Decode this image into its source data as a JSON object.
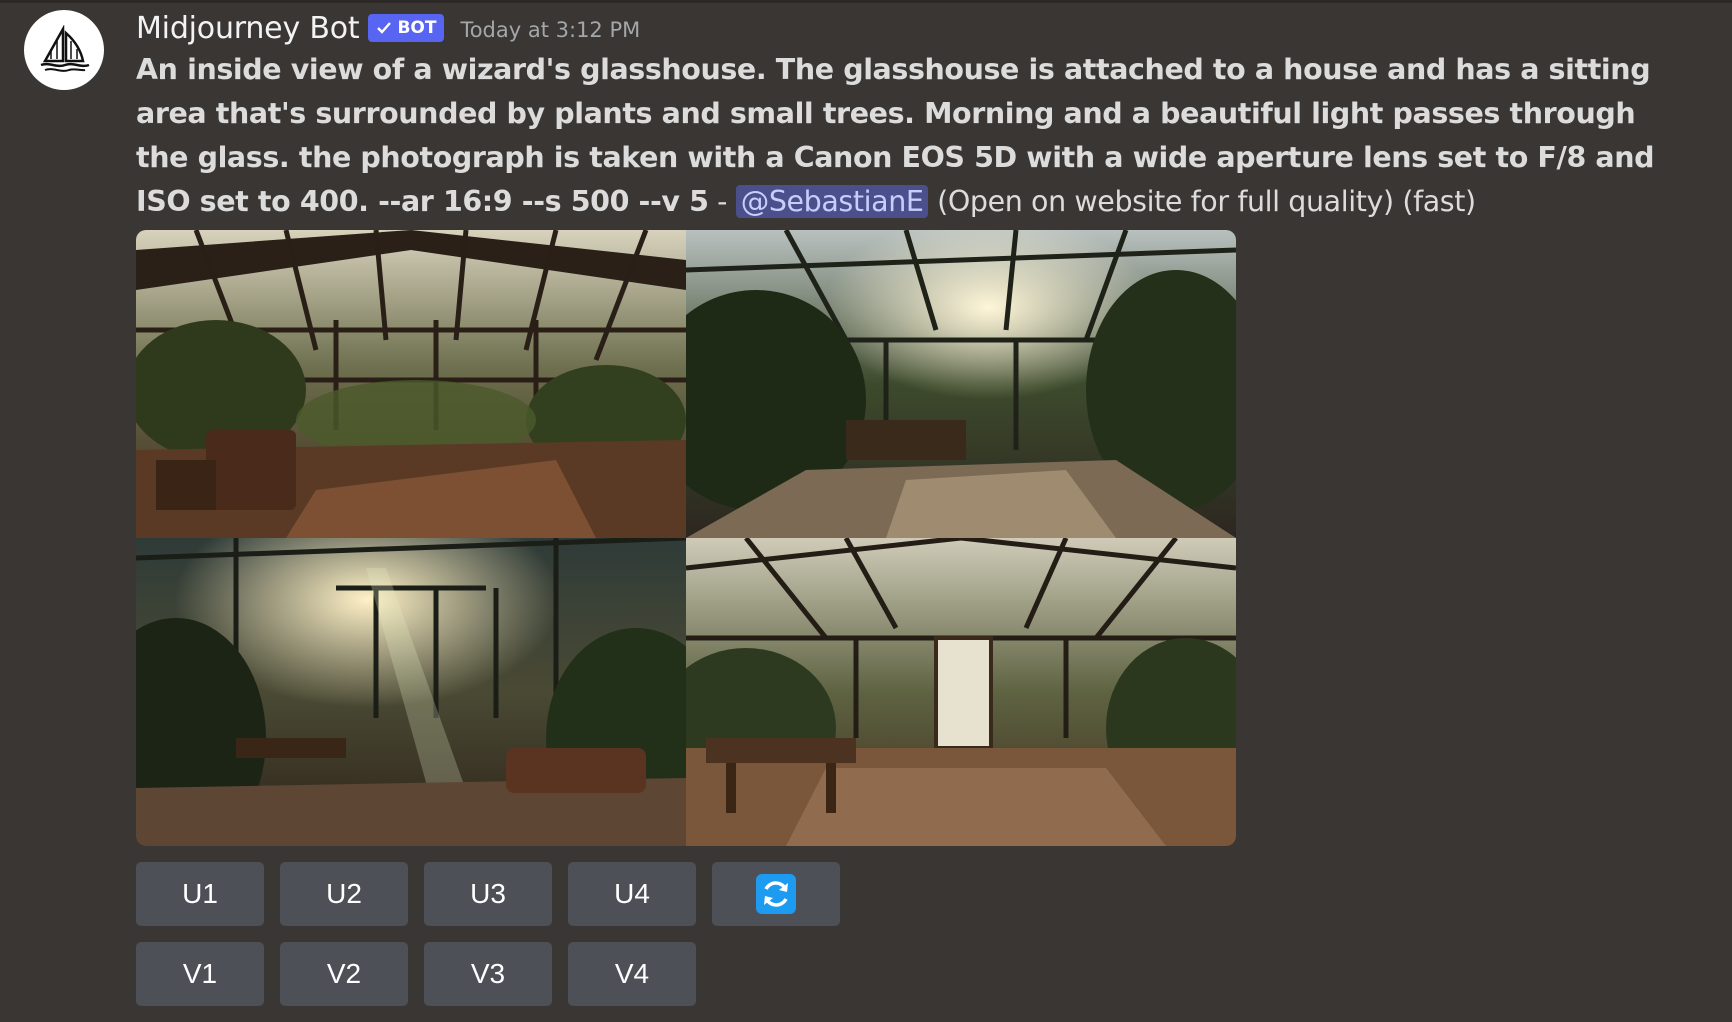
{
  "message": {
    "author": "Midjourney Bot",
    "badge": "BOT",
    "timestamp": "Today at 3:12 PM",
    "prompt": "An inside view of a wizard's glasshouse. The glasshouse is attached to a house and has a sitting area that's surrounded by plants and small trees. Morning and a beautiful light passes through the glass. the photograph is taken with a Canon EOS 5D with a wide aperture lens set to F/8 and ISO set to 400. --ar 16:9 --s 500 --v 5",
    "separator": " - ",
    "mention": "@SebastianE",
    "suffix": " (Open on website for full quality) (fast)"
  },
  "buttons": {
    "upscale": [
      "U1",
      "U2",
      "U3",
      "U4"
    ],
    "variation": [
      "V1",
      "V2",
      "V3",
      "V4"
    ],
    "reroll_icon": "refresh-icon"
  },
  "colors": {
    "background": "#3a3633",
    "button": "#4e5058",
    "badge": "#5865f2",
    "mention_bg": "#4b4f8c",
    "reroll_icon": "#1d9bf0"
  }
}
